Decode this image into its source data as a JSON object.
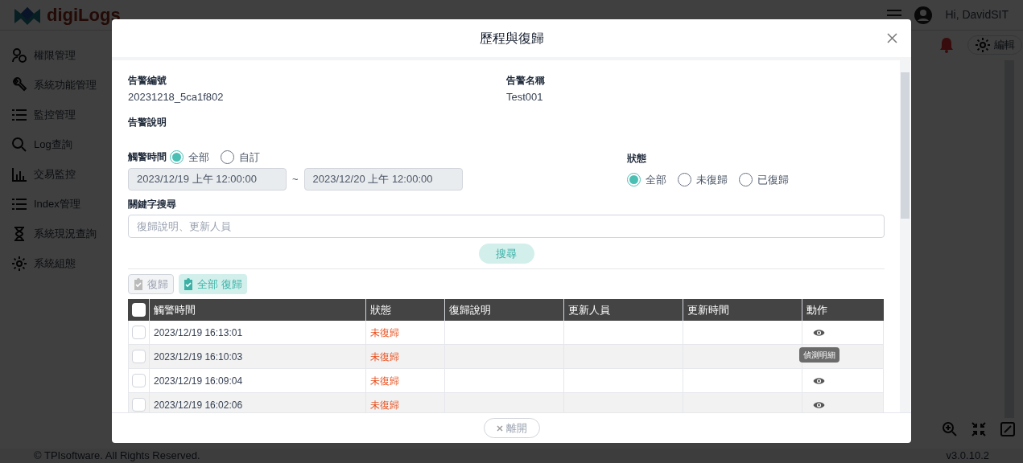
{
  "app": {
    "logo": "digiLogs",
    "user": "Hi, DavidSIT",
    "edit_button": "編輯",
    "nav": [
      "權限管理",
      "系統功能管理",
      "監控管理",
      "Log查詢",
      "交易監控",
      "Index管理",
      "系統現況查詢",
      "系統組態"
    ],
    "copyright": "© TPIsoftware. All Rights Reserved.",
    "version": "v3.0.10.2"
  },
  "dialog": {
    "title": "歷程與復歸",
    "alert_id": {
      "label": "告警編號",
      "value": "20231218_5ca1f802"
    },
    "alert_name": {
      "label": "告警名稱",
      "value": "Test001"
    },
    "alert_description": {
      "label": "告警說明"
    },
    "trigger_time": {
      "label": "觸警時間",
      "options": [
        {
          "label": "全部",
          "selected": true
        },
        {
          "label": "自訂",
          "selected": false
        }
      ],
      "start": "2023/12/19 上午 12:00:00",
      "separator": "~",
      "end": "2023/12/20 上午 12:00:00"
    },
    "status_filter": {
      "label": "狀態",
      "options": [
        {
          "label": "全部",
          "selected": true
        },
        {
          "label": "未復歸",
          "selected": false
        },
        {
          "label": "已復歸",
          "selected": false
        }
      ]
    },
    "keyword": {
      "label": "關鍵字搜尋",
      "placeholder": "復歸說明、更新人員"
    },
    "search_button": "搜尋",
    "restore_button": {
      "label": "復歸",
      "disabled": true
    },
    "restore_all_button": {
      "label": "全部 復歸",
      "disabled": false
    },
    "table": {
      "select_all": {
        "checked": false
      },
      "columns": [
        "觸警時間",
        "狀態",
        "復歸說明",
        "更新人員",
        "更新時間",
        "動作"
      ],
      "rows": [
        {
          "checked": false,
          "trigger_time": "2023/12/19 16:13:01",
          "status": "未復歸"
        },
        {
          "checked": false,
          "trigger_time": "2023/12/19 16:10:03",
          "status": "未復歸",
          "tooltip": "偵測明細"
        },
        {
          "checked": false,
          "trigger_time": "2023/12/19 16:09:04",
          "status": "未復歸"
        },
        {
          "checked": false,
          "trigger_time": "2023/12/19 16:02:06",
          "status": "未復歸"
        }
      ]
    },
    "close_button": "離開"
  }
}
